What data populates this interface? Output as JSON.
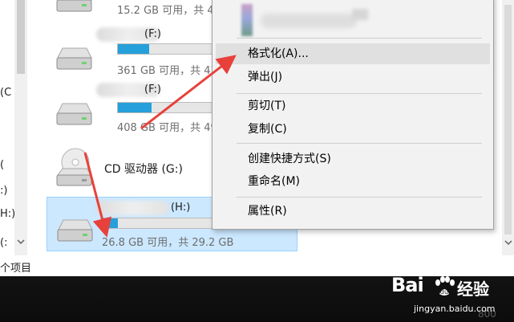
{
  "left_pane": {
    "fragments": [
      "(C",
      "(",
      ":)",
      "H:)",
      "(:"
    ],
    "scroll_down_icon": "chevron-down"
  },
  "drives": [
    {
      "name": "",
      "info": "15.2 GB 可用，共 4",
      "fill_fraction": 0.2,
      "name_blurred": true
    },
    {
      "name": "(F:)",
      "info": "361 GB 可用，共 43",
      "fill_fraction": 0.13,
      "name_blurred": true
    },
    {
      "name": "(F:)",
      "info": "408 GB 可用，共 49",
      "fill_fraction": 0.14,
      "name_blurred": true
    },
    {
      "name": "CD 驱动器 (G:)",
      "info": "",
      "fill_fraction": 0,
      "name_blurred": false
    },
    {
      "name": "(H:)",
      "info": "26.8 GB 可用，共 29.2 GB",
      "fill_fraction": 0.08,
      "name_blurred": true,
      "selected": true
    }
  ],
  "status_bar": {
    "text": "个项目"
  },
  "context_menu": {
    "items": [
      {
        "label": "格式化(A)...",
        "highlighted": true
      },
      {
        "label": "弹出(J)"
      },
      {
        "label": "剪切(T)"
      },
      {
        "label": "复制(C)"
      },
      {
        "label": "创建快捷方式(S)"
      },
      {
        "label": "重命名(M)"
      },
      {
        "label": "属性(R)"
      }
    ]
  },
  "desktop": {
    "corner_text": "800"
  },
  "watermark": {
    "logo": "Bai",
    "logo_suffix": "du",
    "label": "经验",
    "url": "jingyan.baidu.com"
  },
  "colors": {
    "bar_fill": "#26a0da",
    "selection": "#cce8ff",
    "annotation_arrow": "#e8413b",
    "menu_bg": "#f2f2f2"
  }
}
